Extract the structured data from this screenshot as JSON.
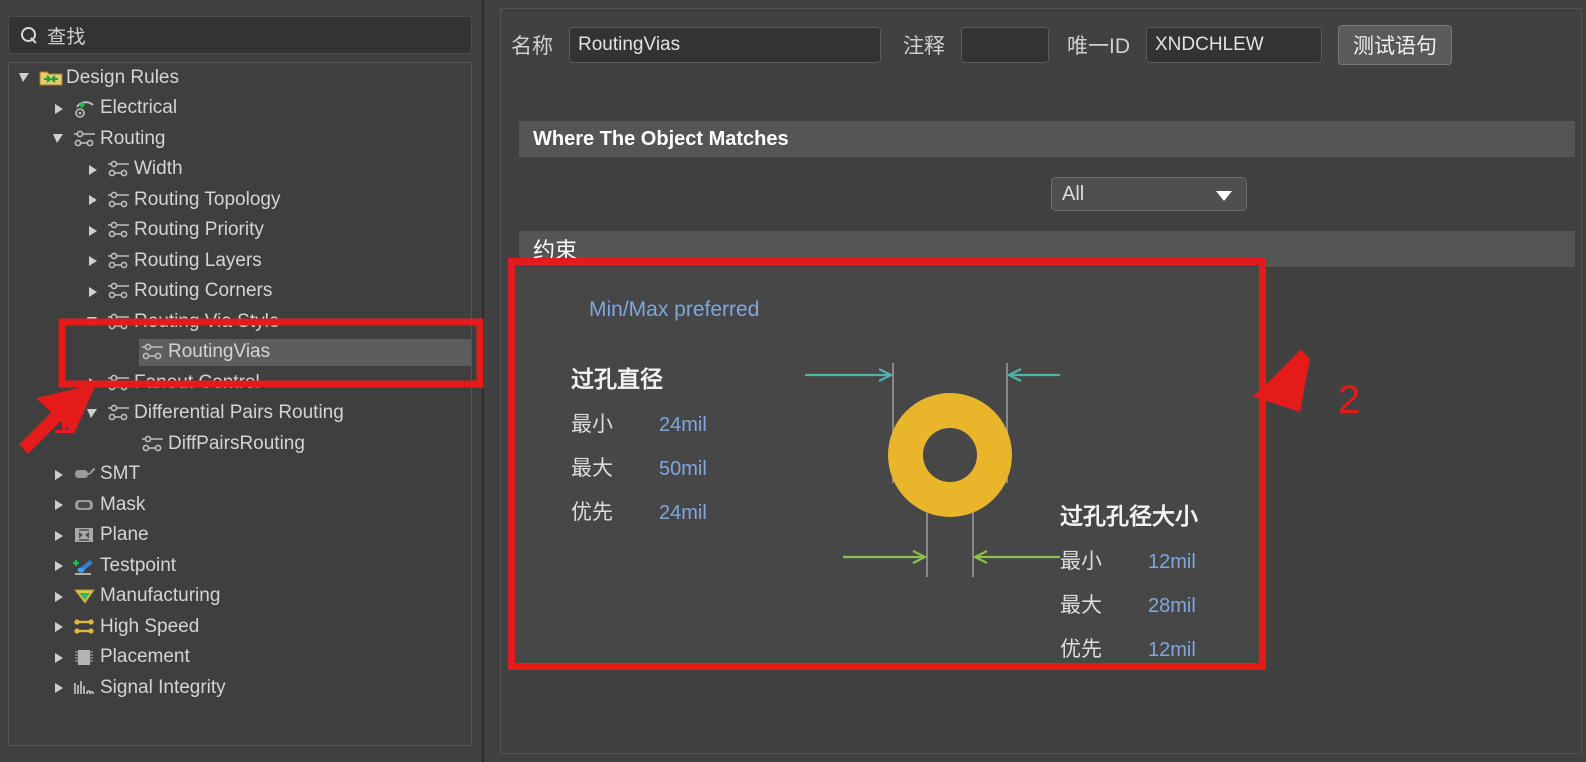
{
  "search": {
    "placeholder": "查找",
    "icon": "search-icon"
  },
  "tree": {
    "items": [
      {
        "label": "Design Rules",
        "depth": 0,
        "twisty": "expanded",
        "icon": "folder-rules-icon",
        "selected": false
      },
      {
        "label": "Electrical",
        "depth": 1,
        "twisty": "collapsed",
        "icon": "electrical-icon",
        "selected": false
      },
      {
        "label": "Routing",
        "depth": 1,
        "twisty": "expanded",
        "icon": "routing-icon",
        "selected": false
      },
      {
        "label": "Width",
        "depth": 2,
        "twisty": "collapsed",
        "icon": "routing-icon",
        "selected": false
      },
      {
        "label": "Routing Topology",
        "depth": 2,
        "twisty": "collapsed",
        "icon": "routing-icon",
        "selected": false
      },
      {
        "label": "Routing Priority",
        "depth": 2,
        "twisty": "collapsed",
        "icon": "routing-icon",
        "selected": false
      },
      {
        "label": "Routing Layers",
        "depth": 2,
        "twisty": "collapsed",
        "icon": "routing-icon",
        "selected": false
      },
      {
        "label": "Routing Corners",
        "depth": 2,
        "twisty": "collapsed",
        "icon": "routing-icon",
        "selected": false
      },
      {
        "label": "Routing Via Style",
        "depth": 2,
        "twisty": "expanded",
        "icon": "routing-icon",
        "selected": false
      },
      {
        "label": "RoutingVias",
        "depth": 3,
        "twisty": "none",
        "icon": "routing-icon",
        "selected": true
      },
      {
        "label": "Fanout Control",
        "depth": 2,
        "twisty": "collapsed",
        "icon": "routing-icon",
        "selected": false
      },
      {
        "label": "Differential Pairs Routing",
        "depth": 2,
        "twisty": "expanded",
        "icon": "routing-icon",
        "selected": false
      },
      {
        "label": "DiffPairsRouting",
        "depth": 3,
        "twisty": "none",
        "icon": "routing-icon",
        "selected": false
      },
      {
        "label": "SMT",
        "depth": 1,
        "twisty": "collapsed",
        "icon": "smt-icon",
        "selected": false
      },
      {
        "label": "Mask",
        "depth": 1,
        "twisty": "collapsed",
        "icon": "mask-icon",
        "selected": false
      },
      {
        "label": "Plane",
        "depth": 1,
        "twisty": "collapsed",
        "icon": "plane-icon",
        "selected": false
      },
      {
        "label": "Testpoint",
        "depth": 1,
        "twisty": "collapsed",
        "icon": "testpoint-icon",
        "selected": false
      },
      {
        "label": "Manufacturing",
        "depth": 1,
        "twisty": "collapsed",
        "icon": "manufacturing-icon",
        "selected": false
      },
      {
        "label": "High Speed",
        "depth": 1,
        "twisty": "collapsed",
        "icon": "highspeed-icon",
        "selected": false
      },
      {
        "label": "Placement",
        "depth": 1,
        "twisty": "collapsed",
        "icon": "placement-icon",
        "selected": false
      },
      {
        "label": "Signal Integrity",
        "depth": 1,
        "twisty": "collapsed",
        "icon": "signal-integrity-icon",
        "selected": false
      }
    ]
  },
  "form": {
    "name_label": "名称",
    "name_value": "RoutingVias",
    "comment_label": "注释",
    "comment_value": "",
    "uid_label": "唯一ID",
    "uid_value": "XNDCHLEW",
    "test_button": "测试语句"
  },
  "where_section": {
    "title": "Where The Object Matches",
    "scope_value": "All"
  },
  "constraint_section": {
    "title": "约束",
    "mode_label": "Min/Max preferred",
    "via_diameter": {
      "title": "过孔直径",
      "rows": [
        {
          "key": "最小",
          "value": "24mil"
        },
        {
          "key": "最大",
          "value": "50mil"
        },
        {
          "key": "优先",
          "value": "24mil"
        }
      ]
    },
    "via_hole_size": {
      "title": "过孔孔径大小",
      "rows": [
        {
          "key": "最小",
          "value": "12mil"
        },
        {
          "key": "最大",
          "value": "28mil"
        },
        {
          "key": "优先",
          "value": "12mil"
        }
      ]
    }
  },
  "annotations": [
    {
      "number": "1",
      "target": "tree-item-routingvias"
    },
    {
      "number": "2",
      "target": "constraint-area"
    }
  ],
  "colors": {
    "highlight_red": "#e51b1b",
    "via_copper": "#e8b52b",
    "value_blue": "#7da7dd",
    "diameter_arrow": "#4fb3ac",
    "hole_arrow": "#8fbe4a"
  }
}
